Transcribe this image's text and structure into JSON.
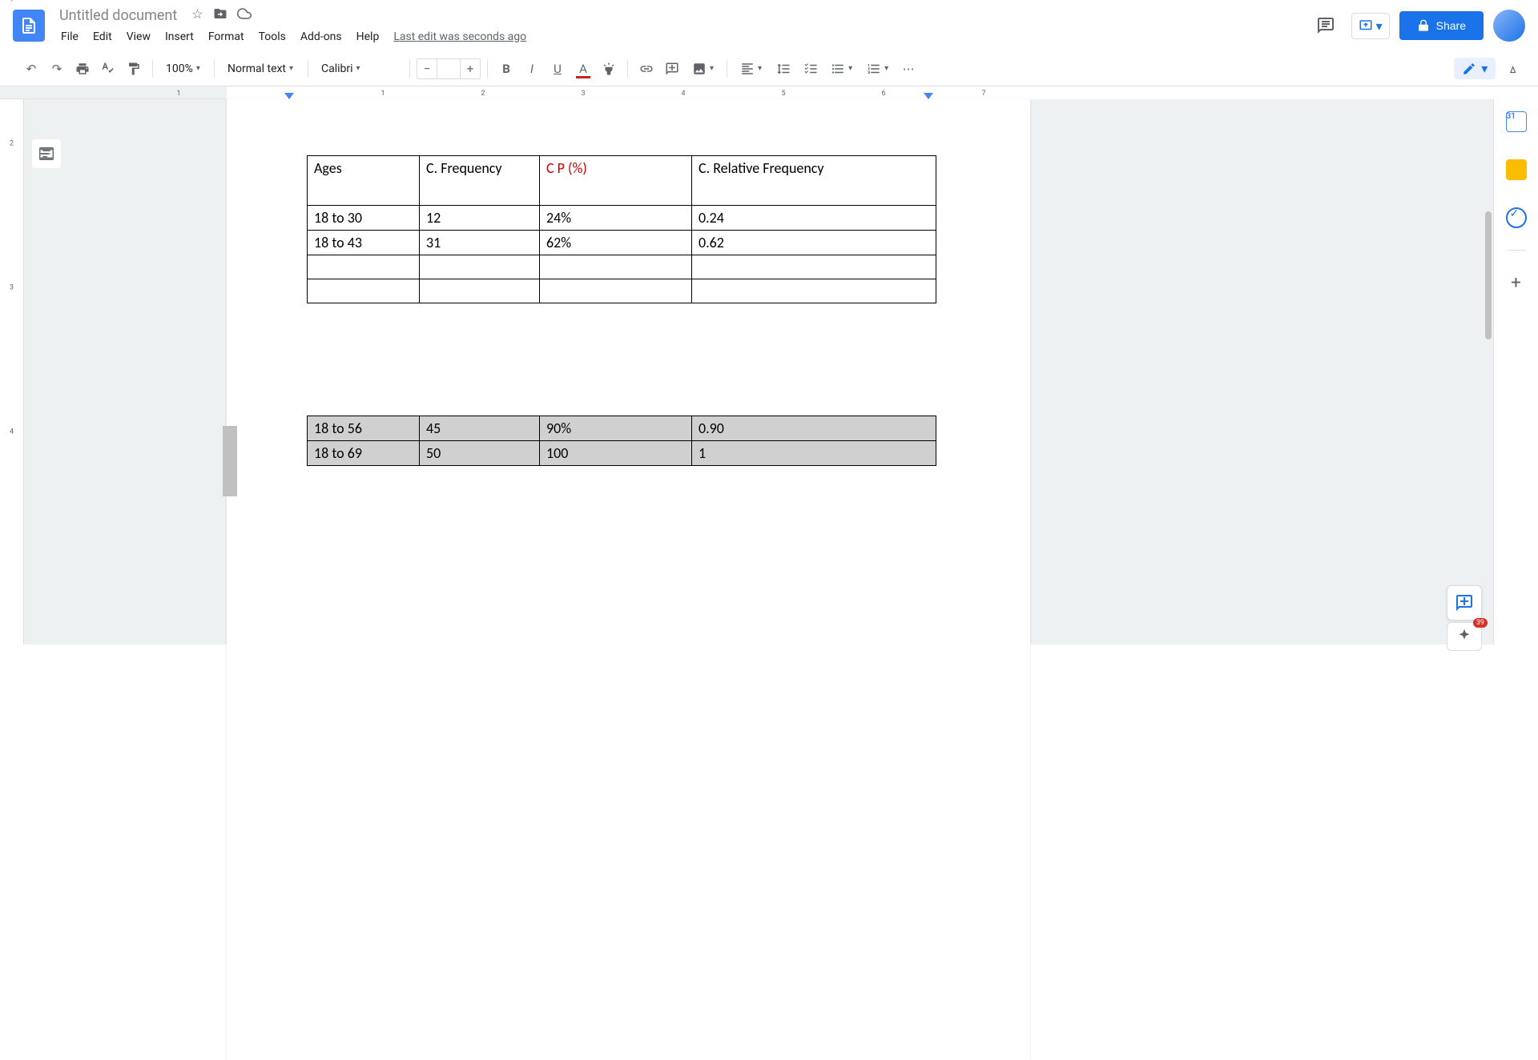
{
  "header": {
    "doc_title": "Untitled document",
    "menu": [
      "File",
      "Edit",
      "View",
      "Insert",
      "Format",
      "Tools",
      "Add-ons",
      "Help"
    ],
    "last_edit": "Last edit was seconds ago",
    "share_label": "Share"
  },
  "toolbar": {
    "zoom": "100%",
    "style": "Normal text",
    "font": "Calibri",
    "font_size": ""
  },
  "ruler_numbers": [
    "1",
    "1",
    "2",
    "3",
    "4",
    "5",
    "6",
    "7"
  ],
  "table1": {
    "headers": [
      "Ages",
      "C. Frequency",
      "C P (%)",
      "C. Relative Frequency"
    ],
    "rows": [
      [
        "18 to 30",
        "12",
        "24%",
        "0.24"
      ],
      [
        "18 to 43",
        "31",
        "62%",
        "0.62"
      ],
      [
        "",
        "",
        "",
        ""
      ],
      [
        "",
        "",
        "",
        ""
      ]
    ]
  },
  "table2": {
    "rows": [
      [
        "18 to 56",
        "45",
        "90%",
        "0.90"
      ],
      [
        "18 to 69",
        "50",
        "100",
        "1"
      ]
    ]
  },
  "side": {
    "calendar_day": "31",
    "explore_badge": "39"
  }
}
